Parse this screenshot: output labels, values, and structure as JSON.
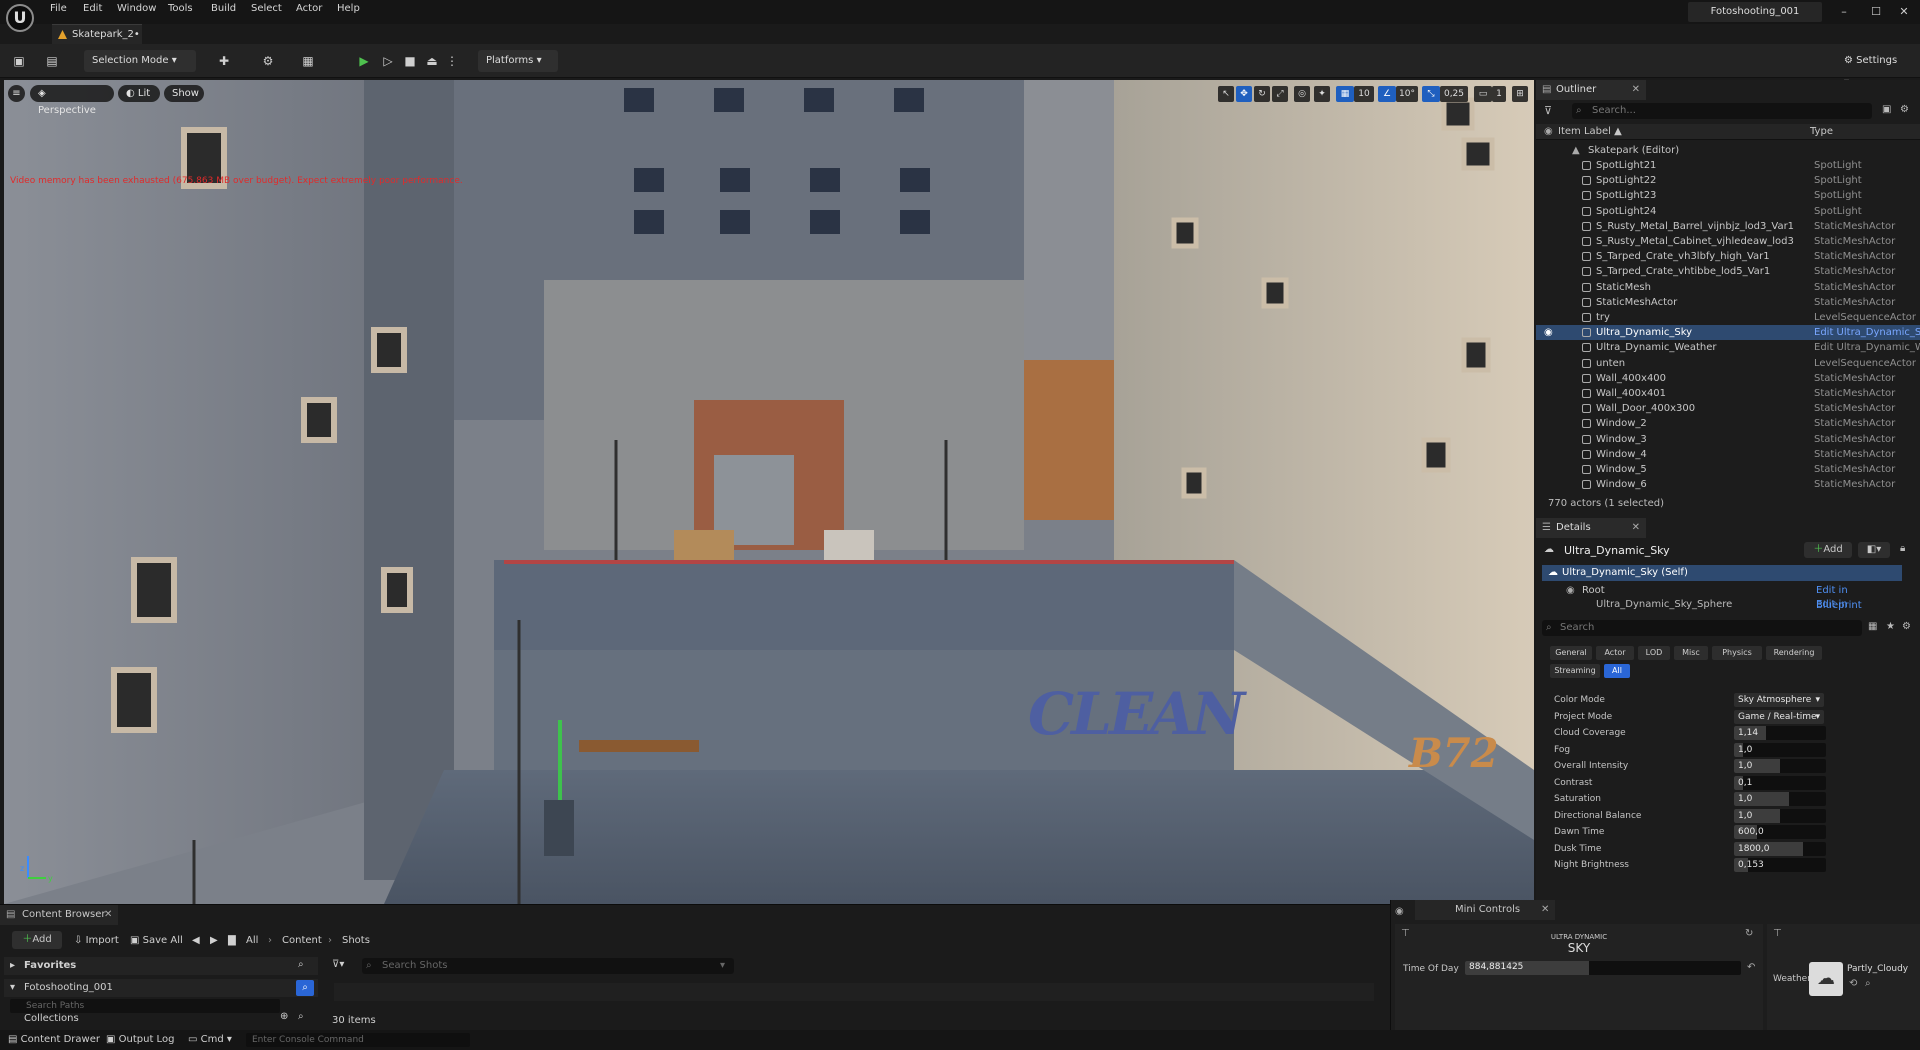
{
  "app": {
    "menu": [
      "File",
      "Edit",
      "Window",
      "Tools",
      "Build",
      "Select",
      "Actor",
      "Help"
    ],
    "document_tab": "Skatepark_2•",
    "project_tab": "Fotoshooting_001",
    "window_buttons": [
      "–",
      "☐",
      "✕"
    ]
  },
  "toolbar": {
    "selection_mode": "Selection Mode",
    "platforms": "Platforms",
    "settings": "Settings"
  },
  "viewport": {
    "perspective": "Perspective",
    "lit": "Lit",
    "show": "Show",
    "warning": "Video memory has been exhausted (675.863 MB over budget). Expect extremely poor performance.",
    "grid_snap": "10",
    "rotation_snap": "10°",
    "scale_snap": "0,25",
    "camera_speed": "1",
    "graffiti_1": "CLEAN",
    "graffiti_2": "B72",
    "axis_z": "z",
    "axis_y": "y"
  },
  "outliner": {
    "tab": "Outliner",
    "search_placeholder": "Search...",
    "col_label": "Item Label ▲",
    "col_type": "Type",
    "root": "Skatepark (Editor)",
    "rows": [
      {
        "name": "SpotLight21",
        "type": "SpotLight"
      },
      {
        "name": "SpotLight22",
        "type": "SpotLight"
      },
      {
        "name": "SpotLight23",
        "type": "SpotLight"
      },
      {
        "name": "SpotLight24",
        "type": "SpotLight"
      },
      {
        "name": "S_Rusty_Metal_Barrel_vijnbjz_lod3_Var1",
        "type": "StaticMeshActor"
      },
      {
        "name": "S_Rusty_Metal_Cabinet_vjhledeaw_lod3",
        "type": "StaticMeshActor"
      },
      {
        "name": "S_Tarped_Crate_vh3lbfy_high_Var1",
        "type": "StaticMeshActor"
      },
      {
        "name": "S_Tarped_Crate_vhtibbe_lod5_Var1",
        "type": "StaticMeshActor"
      },
      {
        "name": "StaticMesh",
        "type": "StaticMeshActor"
      },
      {
        "name": "StaticMeshActor",
        "type": "StaticMeshActor"
      },
      {
        "name": "try",
        "type": "LevelSequenceActor"
      },
      {
        "name": "Ultra_Dynamic_Sky",
        "type": "Edit Ultra_Dynamic_S"
      },
      {
        "name": "Ultra_Dynamic_Weather",
        "type": "Edit Ultra_Dynamic_W"
      },
      {
        "name": "unten",
        "type": "LevelSequenceActor"
      },
      {
        "name": "Wall_400x400",
        "type": "StaticMeshActor"
      },
      {
        "name": "Wall_400x401",
        "type": "StaticMeshActor"
      },
      {
        "name": "Wall_Door_400x300",
        "type": "StaticMeshActor"
      },
      {
        "name": "Window_2",
        "type": "StaticMeshActor"
      },
      {
        "name": "Window_3",
        "type": "StaticMeshActor"
      },
      {
        "name": "Window_4",
        "type": "StaticMeshActor"
      },
      {
        "name": "Window_5",
        "type": "StaticMeshActor"
      },
      {
        "name": "Window_6",
        "type": "StaticMeshActor"
      }
    ],
    "footer": "770 actors (1 selected)"
  },
  "details": {
    "tab": "Details",
    "actor": "Ultra_Dynamic_Sky",
    "add": "Add",
    "self": "Ultra_Dynamic_Sky (Self)",
    "root": "Root",
    "edit_bp": "Edit in Blueprint",
    "sphere": "Ultra_Dynamic_Sky_Sphere",
    "search_placeholder": "Search",
    "categories": [
      "General",
      "Actor",
      "LOD",
      "Misc",
      "Physics",
      "Rendering",
      "Streaming",
      "All"
    ],
    "props": [
      {
        "label": "Color Mode",
        "value": "Sky Atmosphere",
        "kind": "dropdown"
      },
      {
        "label": "Project Mode",
        "value": "Game / Real-time",
        "kind": "dropdown"
      },
      {
        "label": "Cloud Coverage",
        "value": "1,14",
        "fill": 0.35
      },
      {
        "label": "Fog",
        "value": "1,0",
        "fill": 0.1
      },
      {
        "label": "Overall Intensity",
        "value": "1,0",
        "fill": 0.5
      },
      {
        "label": "Contrast",
        "value": "0,1",
        "fill": 0.1
      },
      {
        "label": "Saturation",
        "value": "1,0",
        "fill": 0.6
      },
      {
        "label": "Directional Balance",
        "value": "1,0",
        "fill": 0.5
      },
      {
        "label": "Dawn Time",
        "value": "600,0",
        "fill": 0.25
      },
      {
        "label": "Dusk Time",
        "value": "1800,0",
        "fill": 0.75
      },
      {
        "label": "Night Brightness",
        "value": "0,153",
        "fill": 0.15
      }
    ]
  },
  "content_browser": {
    "tab": "Content Browser",
    "add": "Add",
    "import": "Import",
    "save_all": "Save All",
    "breadcrumb": [
      "All",
      "Content",
      "Shots"
    ],
    "favorites": "Favorites",
    "project_folder": "Fotoshooting_001",
    "search_paths": "Search Paths",
    "collections": "Collections",
    "search_placeholder": "Search Shots",
    "item_count": "30 items"
  },
  "mini_controls": {
    "tab": "Mini Controls",
    "brand_small": "ULTRA DYNAMIC",
    "brand_large": "SKY",
    "time_label": "Time Of Day",
    "time_value": "884,881425",
    "time_fill": 0.45,
    "weather_label": "Weather",
    "weather_value": "Partly_Cloudy"
  },
  "statusbar": {
    "content_drawer": "Content Drawer",
    "output_log": "Output Log",
    "cmd": "Cmd",
    "console_placeholder": "Enter Console Command"
  }
}
